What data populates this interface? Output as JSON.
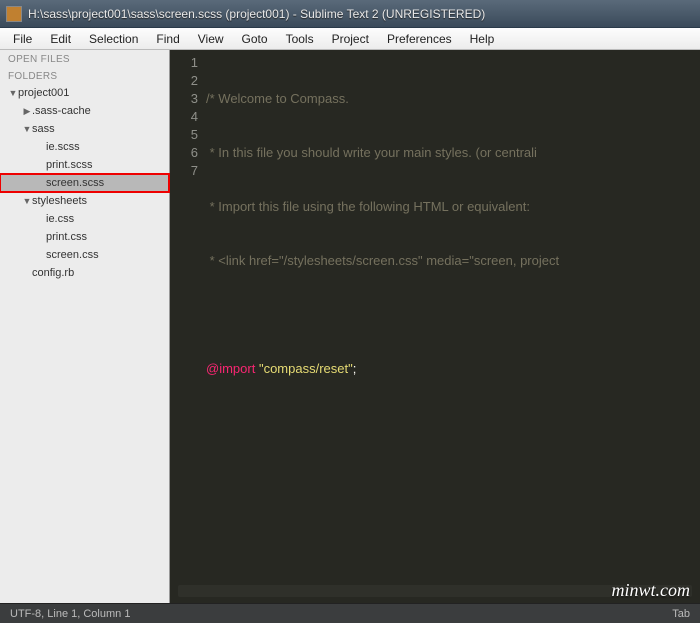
{
  "window": {
    "title": "H:\\sass\\project001\\sass\\screen.scss (project001) - Sublime Text 2 (UNREGISTERED)"
  },
  "menu": {
    "file": "File",
    "edit": "Edit",
    "selection": "Selection",
    "find": "Find",
    "view": "View",
    "goto": "Goto",
    "tools": "Tools",
    "project": "Project",
    "preferences": "Preferences",
    "help": "Help"
  },
  "sidebar": {
    "open_files_header": "OPEN FILES",
    "folders_header": "FOLDERS",
    "tree": {
      "project": "project001",
      "sass_cache": ".sass-cache",
      "sass": "sass",
      "ie_scss": "ie.scss",
      "print_scss": "print.scss",
      "screen_scss": "screen.scss",
      "stylesheets": "stylesheets",
      "ie_css": "ie.css",
      "print_css": "print.css",
      "screen_css": "screen.css",
      "config_rb": "config.rb"
    }
  },
  "editor": {
    "gutter": {
      "l1": "1",
      "l2": "2",
      "l3": "3",
      "l4": "4",
      "l5": "5",
      "l6": "6",
      "l7": "7"
    },
    "code": {
      "l1": "/* Welcome to Compass.",
      "l2": " * In this file you should write your main styles. (or centrali",
      "l3": " * Import this file using the following HTML or equivalent:",
      "l4": " * <link href=\"/stylesheets/screen.css\" media=\"screen, project",
      "l5": "",
      "l6_kw": "@import",
      "l6_sp": " ",
      "l6_str": "\"compass/reset\"",
      "l6_tail": ";",
      "l7": ""
    }
  },
  "statusbar": {
    "left": "UTF-8, Line 1, Column 1",
    "right": "Tab"
  },
  "watermark": "minwt.com"
}
